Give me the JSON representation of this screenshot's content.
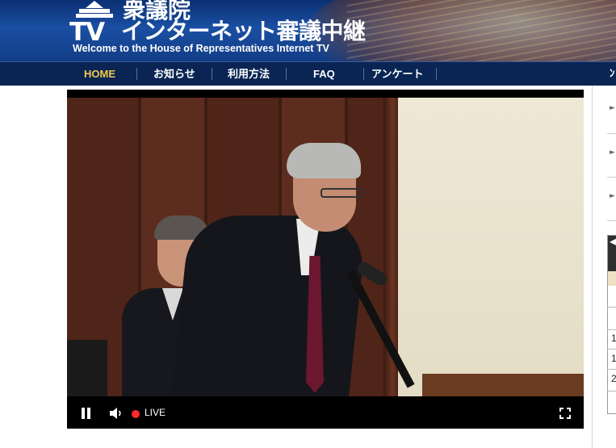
{
  "header": {
    "site_name_top": "衆議院",
    "logo_text": "TV",
    "site_name_main": "インターネット審議中継",
    "tagline": "Welcome to the House of Representatives Internet TV"
  },
  "nav": {
    "items": [
      {
        "label": "HOME",
        "active": true
      },
      {
        "label": "お知らせ",
        "active": false
      },
      {
        "label": "利用方法",
        "active": false
      },
      {
        "label": "FAQ",
        "active": false
      },
      {
        "label": "アンケート",
        "active": false
      }
    ],
    "cutoff_label": "ﾝ"
  },
  "player": {
    "state": "playing",
    "live_label": "LIVE",
    "icons": {
      "pause": "pause-icon",
      "volume": "volume-icon",
      "live": "live-dot-icon",
      "fullscreen": "fullscreen-icon"
    }
  },
  "sidebar": {
    "arrow_glyph": "►",
    "items_visible": 3,
    "table_header_glyph": "◀",
    "table_cells": [
      "1",
      "1",
      "2"
    ]
  },
  "colors": {
    "nav_bg": "#0a2554",
    "nav_active": "#f2c94c",
    "banner_blue": "#1a4fa3",
    "live_red": "#ff2a2a"
  }
}
